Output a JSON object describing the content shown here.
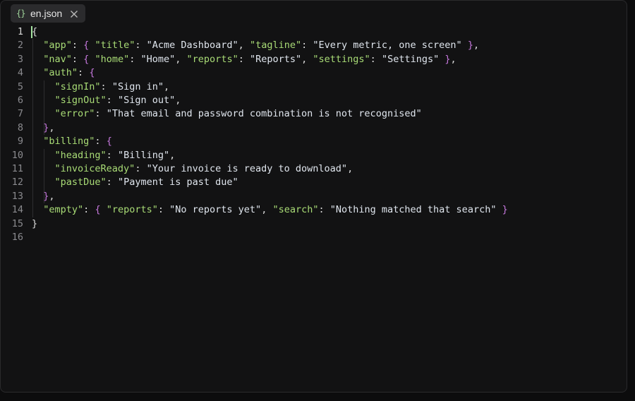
{
  "tab": {
    "icon": "{}",
    "filename": "en.json",
    "close_icon": "close-icon"
  },
  "colors": {
    "key": "#a9dc76",
    "string": "#e0e6ee",
    "brace": "#c678dd",
    "cursor": "#a6e3a1"
  },
  "editor": {
    "active_line": 1,
    "lines": [
      {
        "n": "1",
        "tokens": [
          {
            "t": "root",
            "v": "{"
          }
        ]
      },
      {
        "n": "2",
        "tokens": [
          {
            "t": "sp",
            "v": "  "
          },
          {
            "t": "key",
            "v": "\"app\""
          },
          {
            "t": "punc",
            "v": ": "
          },
          {
            "t": "brace",
            "v": "{"
          },
          {
            "t": "punc",
            "v": " "
          },
          {
            "t": "key",
            "v": "\"title\""
          },
          {
            "t": "punc",
            "v": ": "
          },
          {
            "t": "str",
            "v": "\"Acme Dashboard\""
          },
          {
            "t": "punc",
            "v": ", "
          },
          {
            "t": "key",
            "v": "\"tagline\""
          },
          {
            "t": "punc",
            "v": ": "
          },
          {
            "t": "str",
            "v": "\"Every metric, one screen\""
          },
          {
            "t": "punc",
            "v": " "
          },
          {
            "t": "brace",
            "v": "}"
          },
          {
            "t": "punc",
            "v": ","
          }
        ]
      },
      {
        "n": "3",
        "tokens": [
          {
            "t": "sp",
            "v": "  "
          },
          {
            "t": "key",
            "v": "\"nav\""
          },
          {
            "t": "punc",
            "v": ": "
          },
          {
            "t": "brace",
            "v": "{"
          },
          {
            "t": "punc",
            "v": " "
          },
          {
            "t": "key",
            "v": "\"home\""
          },
          {
            "t": "punc",
            "v": ": "
          },
          {
            "t": "str",
            "v": "\"Home\""
          },
          {
            "t": "punc",
            "v": ", "
          },
          {
            "t": "key",
            "v": "\"reports\""
          },
          {
            "t": "punc",
            "v": ": "
          },
          {
            "t": "str",
            "v": "\"Reports\""
          },
          {
            "t": "punc",
            "v": ", "
          },
          {
            "t": "key",
            "v": "\"settings\""
          },
          {
            "t": "punc",
            "v": ": "
          },
          {
            "t": "str",
            "v": "\"Settings\""
          },
          {
            "t": "punc",
            "v": " "
          },
          {
            "t": "brace",
            "v": "}"
          },
          {
            "t": "punc",
            "v": ","
          }
        ]
      },
      {
        "n": "4",
        "tokens": [
          {
            "t": "sp",
            "v": "  "
          },
          {
            "t": "key",
            "v": "\"auth\""
          },
          {
            "t": "punc",
            "v": ": "
          },
          {
            "t": "brace",
            "v": "{"
          }
        ]
      },
      {
        "n": "5",
        "tokens": [
          {
            "t": "sp",
            "v": "    "
          },
          {
            "t": "key",
            "v": "\"signIn\""
          },
          {
            "t": "punc",
            "v": ": "
          },
          {
            "t": "str",
            "v": "\"Sign in\""
          },
          {
            "t": "punc",
            "v": ","
          }
        ]
      },
      {
        "n": "6",
        "tokens": [
          {
            "t": "sp",
            "v": "    "
          },
          {
            "t": "key",
            "v": "\"signOut\""
          },
          {
            "t": "punc",
            "v": ": "
          },
          {
            "t": "str",
            "v": "\"Sign out\""
          },
          {
            "t": "punc",
            "v": ","
          }
        ]
      },
      {
        "n": "7",
        "tokens": [
          {
            "t": "sp",
            "v": "    "
          },
          {
            "t": "key",
            "v": "\"error\""
          },
          {
            "t": "punc",
            "v": ": "
          },
          {
            "t": "str",
            "v": "\"That email and password combination is not recognised\""
          }
        ]
      },
      {
        "n": "8",
        "tokens": [
          {
            "t": "sp",
            "v": "  "
          },
          {
            "t": "brace",
            "v": "}"
          },
          {
            "t": "punc",
            "v": ","
          }
        ]
      },
      {
        "n": "9",
        "tokens": [
          {
            "t": "sp",
            "v": "  "
          },
          {
            "t": "key",
            "v": "\"billing\""
          },
          {
            "t": "punc",
            "v": ": "
          },
          {
            "t": "brace",
            "v": "{"
          }
        ]
      },
      {
        "n": "10",
        "tokens": [
          {
            "t": "sp",
            "v": "    "
          },
          {
            "t": "key",
            "v": "\"heading\""
          },
          {
            "t": "punc",
            "v": ": "
          },
          {
            "t": "str",
            "v": "\"Billing\""
          },
          {
            "t": "punc",
            "v": ","
          }
        ]
      },
      {
        "n": "11",
        "tokens": [
          {
            "t": "sp",
            "v": "    "
          },
          {
            "t": "key",
            "v": "\"invoiceReady\""
          },
          {
            "t": "punc",
            "v": ": "
          },
          {
            "t": "str",
            "v": "\"Your invoice is ready to download\""
          },
          {
            "t": "punc",
            "v": ","
          }
        ]
      },
      {
        "n": "12",
        "tokens": [
          {
            "t": "sp",
            "v": "    "
          },
          {
            "t": "key",
            "v": "\"pastDue\""
          },
          {
            "t": "punc",
            "v": ": "
          },
          {
            "t": "str",
            "v": "\"Payment is past due\""
          }
        ]
      },
      {
        "n": "13",
        "tokens": [
          {
            "t": "sp",
            "v": "  "
          },
          {
            "t": "brace",
            "v": "}"
          },
          {
            "t": "punc",
            "v": ","
          }
        ]
      },
      {
        "n": "14",
        "tokens": [
          {
            "t": "sp",
            "v": "  "
          },
          {
            "t": "key",
            "v": "\"empty\""
          },
          {
            "t": "punc",
            "v": ": "
          },
          {
            "t": "brace",
            "v": "{"
          },
          {
            "t": "punc",
            "v": " "
          },
          {
            "t": "key",
            "v": "\"reports\""
          },
          {
            "t": "punc",
            "v": ": "
          },
          {
            "t": "str",
            "v": "\"No reports yet\""
          },
          {
            "t": "punc",
            "v": ", "
          },
          {
            "t": "key",
            "v": "\"search\""
          },
          {
            "t": "punc",
            "v": ": "
          },
          {
            "t": "str",
            "v": "\"Nothing matched that search\""
          },
          {
            "t": "punc",
            "v": " "
          },
          {
            "t": "brace",
            "v": "}"
          }
        ]
      },
      {
        "n": "15",
        "tokens": [
          {
            "t": "root",
            "v": "}"
          }
        ]
      },
      {
        "n": "16",
        "tokens": []
      }
    ]
  }
}
